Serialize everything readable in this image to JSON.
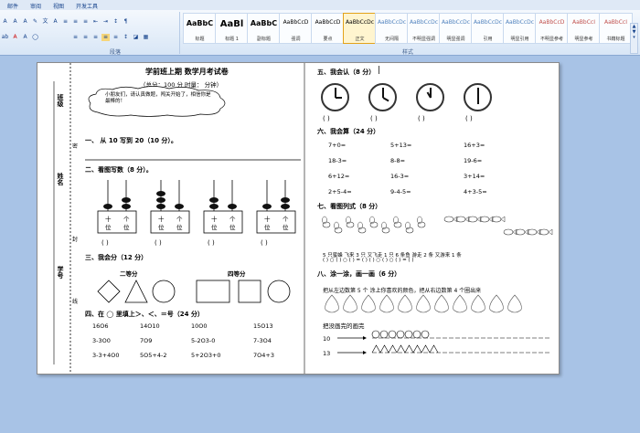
{
  "menu": [
    "邮件",
    "审阅",
    "视图",
    "开发工具"
  ],
  "ribbon": {
    "font_group_label": "段落",
    "styles_group_label": "样式",
    "styles": [
      {
        "sample": "AaBbC",
        "name": "标题"
      },
      {
        "sample": "AaBl",
        "name": "标题 1"
      },
      {
        "sample": "AaBbC",
        "name": "副标题"
      },
      {
        "sample": "AaBbCcD",
        "name": "强调"
      },
      {
        "sample": "AaBbCcD",
        "name": "要点"
      },
      {
        "sample": "AaBbCcDc",
        "name": "正文"
      },
      {
        "sample": "AaBbCcDc",
        "name": "无间隔"
      },
      {
        "sample": "AaBbCcDc",
        "name": "不明显强调"
      },
      {
        "sample": "AaBbCcDc",
        "name": "明显强调"
      },
      {
        "sample": "AaBbCcDc",
        "name": "引用"
      },
      {
        "sample": "AaBbCcDc",
        "name": "明显引用"
      },
      {
        "sample": "AaBbCcD",
        "name": "不明显参考"
      },
      {
        "sample": "AaBbCcI",
        "name": "明显参考"
      },
      {
        "sample": "AaBbCcI",
        "name": "书籍标题"
      }
    ],
    "selected_style": 5,
    "accent": "#e3a21a"
  },
  "doc": {
    "side": {
      "class": "班级",
      "name": "姓名",
      "id": "学号",
      "seal1": "密",
      "seal2": "封",
      "seal3": "线"
    },
    "title": "学前班上期    数学月考试卷",
    "score_line": "（总分：100 分      时量：        分钟）",
    "cloud": "小朋友们，请认真做题，闯关开始了，相信你是最棒的！",
    "q1": "一、 从 10 写到 20（10 分）。",
    "q2": "二、看图写数（8 分）。",
    "abacus_labels": [
      "十",
      "个",
      "位",
      "位"
    ],
    "paren": "(       )",
    "q3": "三、我会分（12 分）",
    "q3_two": "二等分",
    "q3_four": "四等分",
    "q4": "四、在 ◯ 里填上＞、＜、＝号（24 分）",
    "q4_items": [
      "16O6",
      "14O10",
      "10O0",
      "15O13",
      "3-3O0",
      "7O9",
      "5-2O3-0",
      "7-3O4",
      "3-3+4O0",
      "5O5+4-2",
      "5+2O3+0",
      "7O4+3"
    ],
    "q5": "五、我会认（8 分）",
    "q6": "六、我会算（24 分）",
    "q6_items": [
      "7+0=",
      "5+13=",
      "16+3=",
      "18-3=",
      "8-8=",
      "19-6=",
      "6+12=",
      "16-3=",
      "3+14=",
      "2+5-4=",
      "9-4-5=",
      "4+3-5="
    ],
    "q7": "七、看图列式（8 分）",
    "q7_caption": "5 只蜜蜂    飞来 3 只    又飞走 1 只          6 条鱼        游走 2 条  又游来 1 条",
    "q7_formula": "(    ) ○ (    ) ○ (    ) = (    )      (    ) ○ (    ) ○ (    ) = (    )",
    "q8": "八、涂一涂，画一画（6 分）",
    "q8_line1": "把从左边数第 5 个        涂上你喜欢的颜色，把从右边数第 4 个圈出来",
    "q8_line2": "把没画完的画完",
    "q8_n1": "10",
    "q8_n2": "13",
    "arrow": "→"
  }
}
